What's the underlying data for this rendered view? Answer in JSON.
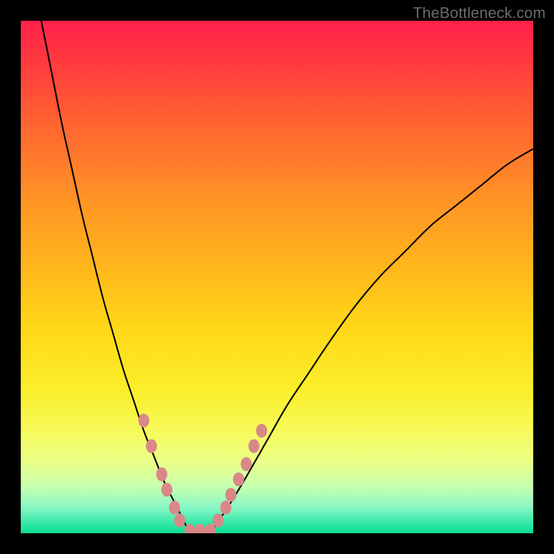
{
  "watermark": "TheBottleneck.com",
  "chart_data": {
    "type": "line",
    "title": "",
    "xlabel": "",
    "ylabel": "",
    "xlim": [
      0,
      100
    ],
    "ylim": [
      0,
      100
    ],
    "grid": false,
    "legend": false,
    "series": [
      {
        "name": "left-curve",
        "x": [
          4,
          6,
          8,
          10,
          12,
          14,
          16,
          18,
          20,
          22,
          24,
          26,
          28,
          30,
          32,
          33
        ],
        "y": [
          100,
          90,
          80,
          71,
          62,
          54,
          46,
          39,
          32,
          26,
          20,
          15,
          10,
          6,
          2,
          0
        ]
      },
      {
        "name": "right-curve",
        "x": [
          37,
          39,
          41,
          44,
          48,
          52,
          56,
          60,
          65,
          70,
          75,
          80,
          85,
          90,
          95,
          100
        ],
        "y": [
          0,
          3,
          6,
          11,
          18,
          25,
          31,
          37,
          44,
          50,
          55,
          60,
          64,
          68,
          72,
          75
        ]
      }
    ],
    "markers": {
      "name": "pink-dots",
      "color": "#d98888",
      "points": [
        {
          "x": 24.0,
          "y": 22.0
        },
        {
          "x": 25.5,
          "y": 17.0
        },
        {
          "x": 27.5,
          "y": 11.5
        },
        {
          "x": 28.5,
          "y": 8.5
        },
        {
          "x": 30.0,
          "y": 5.0
        },
        {
          "x": 31.0,
          "y": 2.5
        },
        {
          "x": 33.0,
          "y": 0.5
        },
        {
          "x": 35.0,
          "y": 0.5
        },
        {
          "x": 37.0,
          "y": 0.5
        },
        {
          "x": 38.5,
          "y": 2.5
        },
        {
          "x": 40.0,
          "y": 5.0
        },
        {
          "x": 41.0,
          "y": 7.5
        },
        {
          "x": 42.5,
          "y": 10.5
        },
        {
          "x": 44.0,
          "y": 13.5
        },
        {
          "x": 45.5,
          "y": 17.0
        },
        {
          "x": 47.0,
          "y": 20.0
        }
      ]
    },
    "gradient_stops": [
      {
        "offset": 0.0,
        "color": "#ff1f4b"
      },
      {
        "offset": 0.5,
        "color": "#ffd818"
      },
      {
        "offset": 1.0,
        "color": "#0adf90"
      }
    ]
  }
}
